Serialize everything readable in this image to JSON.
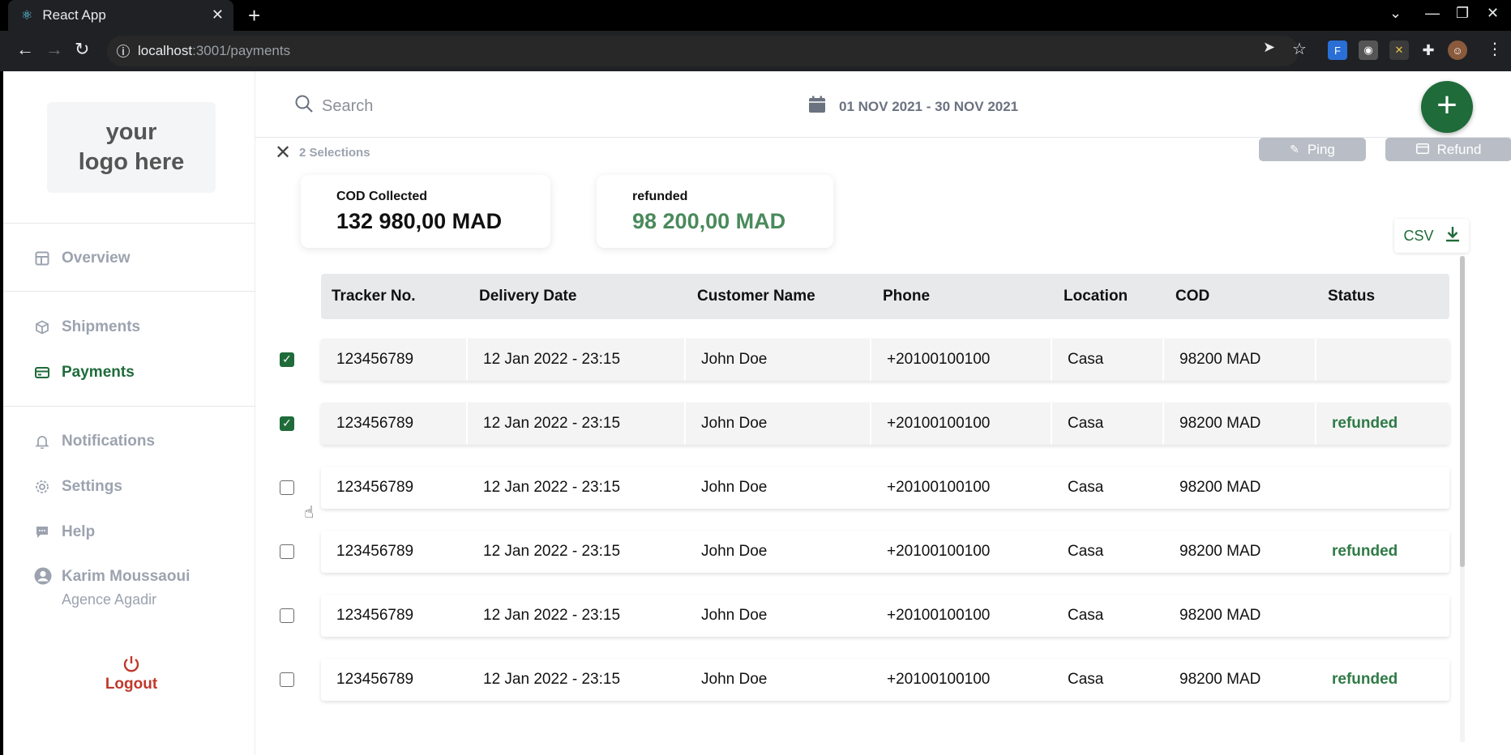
{
  "browser": {
    "tab_title": "React App",
    "url_host": "localhost",
    "url_path": ":3001/payments"
  },
  "sidebar": {
    "logo_line1": "your",
    "logo_line2": "logo here",
    "items": [
      {
        "label": "Overview",
        "icon": "layout-icon"
      },
      {
        "label": "Shipments",
        "icon": "box-icon"
      },
      {
        "label": "Payments",
        "icon": "credit-card-icon",
        "active": true
      },
      {
        "label": "Notifications",
        "icon": "bell-icon"
      },
      {
        "label": "Settings",
        "icon": "gear-icon"
      },
      {
        "label": "Help",
        "icon": "chat-icon"
      }
    ],
    "user_name": "Karim Moussaoui",
    "user_agency": "Agence Agadir",
    "logout_label": "Logout"
  },
  "topbar": {
    "search_placeholder": "Search",
    "date_range": "01 NOV 2021 - 30 NOV 2021"
  },
  "selection": {
    "count_label": "2 Selections",
    "ping_label": "Ping",
    "refund_label": "Refund"
  },
  "cards": {
    "cod_label": "COD Collected",
    "cod_value": "132 980,00 MAD",
    "refunded_label": "refunded",
    "refunded_value": "98 200,00 MAD"
  },
  "csv_label": "CSV",
  "table": {
    "headers": [
      "Tracker No.",
      "Delivery Date",
      "Customer Name",
      "Phone",
      "Location",
      "COD",
      "Status"
    ],
    "rows": [
      {
        "checked": true,
        "tracker": "123456789",
        "date": "12 Jan 2022 - 23:15",
        "customer": "John Doe",
        "phone": "+20100100100",
        "location": "Casa",
        "cod": "98200 MAD",
        "status": ""
      },
      {
        "checked": true,
        "tracker": "123456789",
        "date": "12 Jan 2022 - 23:15",
        "customer": "John Doe",
        "phone": "+20100100100",
        "location": "Casa",
        "cod": "98200 MAD",
        "status": "refunded"
      },
      {
        "checked": false,
        "tracker": "123456789",
        "date": "12 Jan 2022 - 23:15",
        "customer": "John Doe",
        "phone": "+20100100100",
        "location": "Casa",
        "cod": "98200 MAD",
        "status": ""
      },
      {
        "checked": false,
        "tracker": "123456789",
        "date": "12 Jan 2022 - 23:15",
        "customer": "John Doe",
        "phone": "+20100100100",
        "location": "Casa",
        "cod": "98200 MAD",
        "status": "refunded"
      },
      {
        "checked": false,
        "tracker": "123456789",
        "date": "12 Jan 2022 - 23:15",
        "customer": "John Doe",
        "phone": "+20100100100",
        "location": "Casa",
        "cod": "98200 MAD",
        "status": ""
      },
      {
        "checked": false,
        "tracker": "123456789",
        "date": "12 Jan 2022 - 23:15",
        "customer": "John Doe",
        "phone": "+20100100100",
        "location": "Casa",
        "cod": "98200 MAD",
        "status": "refunded"
      }
    ]
  },
  "colors": {
    "brand_green": "#1f6b3a",
    "refunded_green": "#4a8a5c",
    "logout_red": "#c0392b"
  }
}
